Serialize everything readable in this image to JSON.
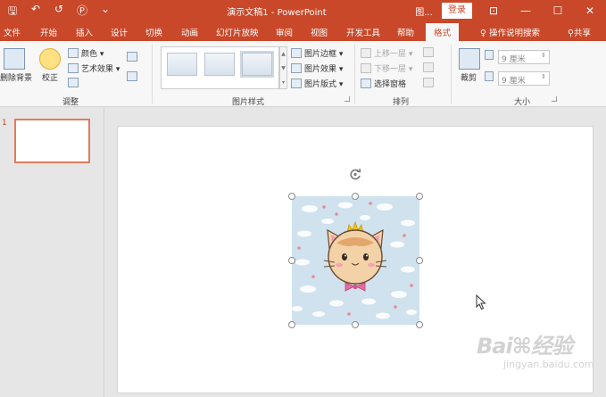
{
  "titlebar": {
    "quick_access": {
      "save": "🖫",
      "undo": "↶",
      "redo": "↺",
      "touch": "Ⓟ",
      "customize": "⌄"
    },
    "title": "演示文稿1 - PowerPoint",
    "picture_tools": "图...",
    "login": "登录",
    "ribbon_display": "⊡",
    "minimize": "—",
    "maximize": "☐",
    "close": "✕"
  },
  "tabs": [
    "文件",
    "开始",
    "插入",
    "设计",
    "切换",
    "动画",
    "幻灯片放映",
    "审阅",
    "视图",
    "开发工具",
    "帮助"
  ],
  "active_tab": "格式",
  "tell_me": "操作说明搜索",
  "share": "共享",
  "ribbon": {
    "adjust": {
      "remove_bg": "删除背景",
      "corrections": "校正",
      "color": "颜色 ▾",
      "artistic": "艺术效果 ▾",
      "label": "调整"
    },
    "picture_styles": {
      "border": "图片边框 ▾",
      "effects": "图片效果 ▾",
      "layout": "图片版式 ▾",
      "label": "图片样式"
    },
    "arrange": {
      "bring_forward": "上移一层 ▾",
      "send_backward": "下移一层 ▾",
      "selection_pane": "选择窗格",
      "label": "排列"
    },
    "size": {
      "crop": "裁剪",
      "height": "9 厘米",
      "width": "9 厘米",
      "label": "大小"
    }
  },
  "slides": {
    "number": "1"
  },
  "watermark": {
    "text": "jingyan.baidu.com"
  },
  "colors": {
    "accent": "#c9482a",
    "thumb_selected": "#e07a5f",
    "picture_bg": "#cfe2ee"
  }
}
